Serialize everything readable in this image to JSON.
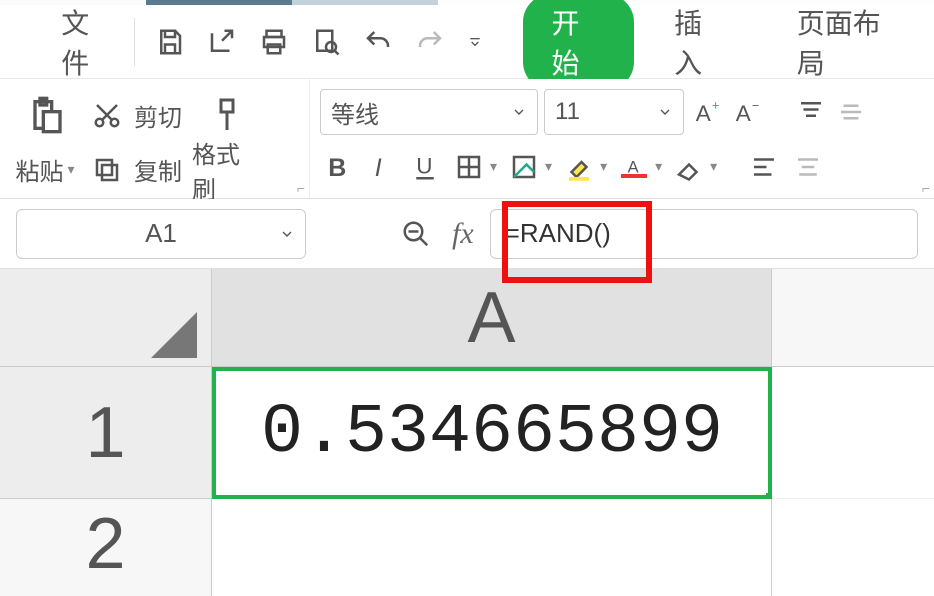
{
  "menu": {
    "file_label": "文件",
    "tabs": [
      {
        "label": "开始",
        "active": true
      },
      {
        "label": "插入",
        "active": false
      },
      {
        "label": "页面布局",
        "active": false
      }
    ]
  },
  "ribbon": {
    "clipboard": {
      "paste_label": "粘贴",
      "cut_label": "剪切",
      "copy_label": "复制",
      "format_painter_label": "格式刷"
    },
    "font": {
      "name": "等线",
      "size": "11"
    }
  },
  "namebox": {
    "value": "A1"
  },
  "formulabar": {
    "value": "=RAND()"
  },
  "sheet": {
    "col_headers": [
      "A"
    ],
    "row_headers": [
      "1",
      "2"
    ],
    "cells": {
      "A1": "0.534665899"
    }
  }
}
